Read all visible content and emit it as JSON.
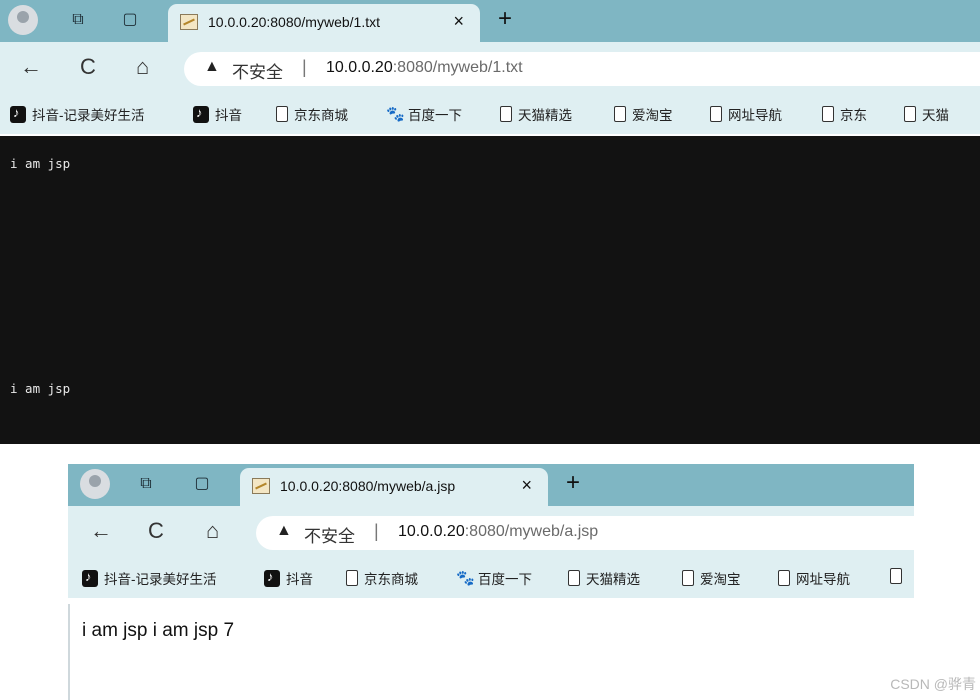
{
  "top_window": {
    "tab_title": "10.0.0.20:8080/myweb/1.txt",
    "close_glyph": "×",
    "new_tab_glyph": "+",
    "address": {
      "warning_icon": "warning-triangle-icon",
      "insecure_label": "不安全",
      "separator": "|",
      "url_host": "10.0.0.20",
      "url_rest": ":8080/myweb/1.txt"
    },
    "bookmarks": [
      "抖音-记录美好生活",
      "抖音",
      "京东商城",
      "百度一下",
      "天猫精选",
      "爱淘宝",
      "网址导航",
      "京东",
      "天猫"
    ],
    "content_lines": [
      "i am jsp",
      "i am jsp"
    ]
  },
  "bottom_window": {
    "tab_title": "10.0.0.20:8080/myweb/a.jsp",
    "close_glyph": "×",
    "new_tab_glyph": "+",
    "address": {
      "warning_icon": "warning-triangle-icon",
      "insecure_label": "不安全",
      "separator": "|",
      "url_host": "10.0.0.20",
      "url_rest": ":8080/myweb/a.jsp"
    },
    "bookmarks": [
      "抖音-记录美好生活",
      "抖音",
      "京东商城",
      "百度一下",
      "天猫精选",
      "爱淘宝",
      "网址导航",
      ""
    ],
    "content_text": "i am jsp i am jsp 7"
  },
  "nav_icons": {
    "back": "←",
    "reload": "C",
    "home": "⌂"
  },
  "watermark": "CSDN @骅青",
  "colors": {
    "tabstrip": "#7fb6c3",
    "toolbar": "#dfeff2",
    "dark_page": "#121212"
  }
}
